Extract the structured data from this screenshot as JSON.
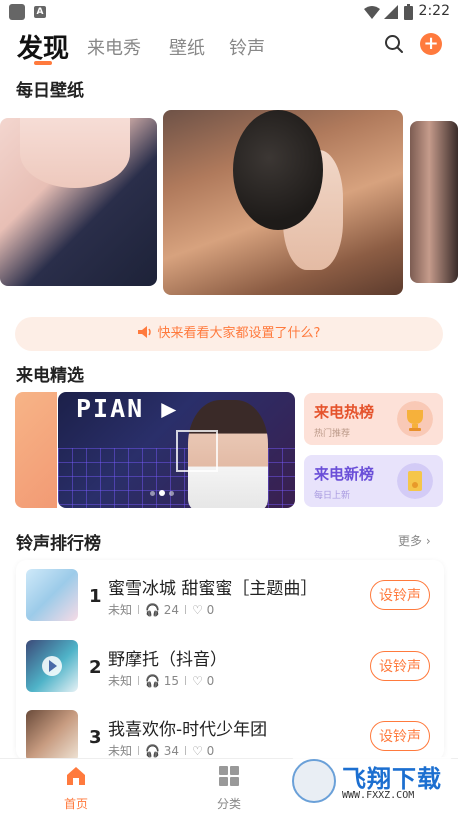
{
  "status_bar": {
    "time": "2:22",
    "notification_icon_letter": "A"
  },
  "top_tabs": {
    "active": "发现",
    "tabs": [
      "来电秀",
      "壁纸",
      "铃声"
    ]
  },
  "daily_wallpaper": {
    "title": "每日壁纸"
  },
  "notice": {
    "text": "快来看看大家都设置了什么?"
  },
  "ringtone_picks": {
    "title": "来电精选",
    "banner_text": "PIAN ▶",
    "hot": {
      "title": "来电热榜",
      "subtitle": "热门推荐",
      "color": "#e5532c"
    },
    "new": {
      "title": "来电新榜",
      "subtitle": "每日上新",
      "color": "#6a4fd8"
    }
  },
  "ranking": {
    "title": "铃声排行榜",
    "more": "更多",
    "button_label": "设铃声",
    "items": [
      {
        "rank": "1",
        "title": "蜜雪冰城 甜蜜蜜［主题曲］",
        "artist": "未知",
        "plays": "24",
        "likes": "0"
      },
      {
        "rank": "2",
        "title": "野摩托（抖音）",
        "artist": "未知",
        "plays": "15",
        "likes": "0"
      },
      {
        "rank": "3",
        "title": "我喜欢你-时代少年团",
        "artist": "未知",
        "plays": "34",
        "likes": "0"
      }
    ]
  },
  "bottom_nav": {
    "items": [
      "首页",
      "分类"
    ]
  },
  "watermark": {
    "brand": "飞翔下载",
    "url": "WWW.FXXZ.COM"
  },
  "colors": {
    "accent": "#ff7a3d"
  }
}
